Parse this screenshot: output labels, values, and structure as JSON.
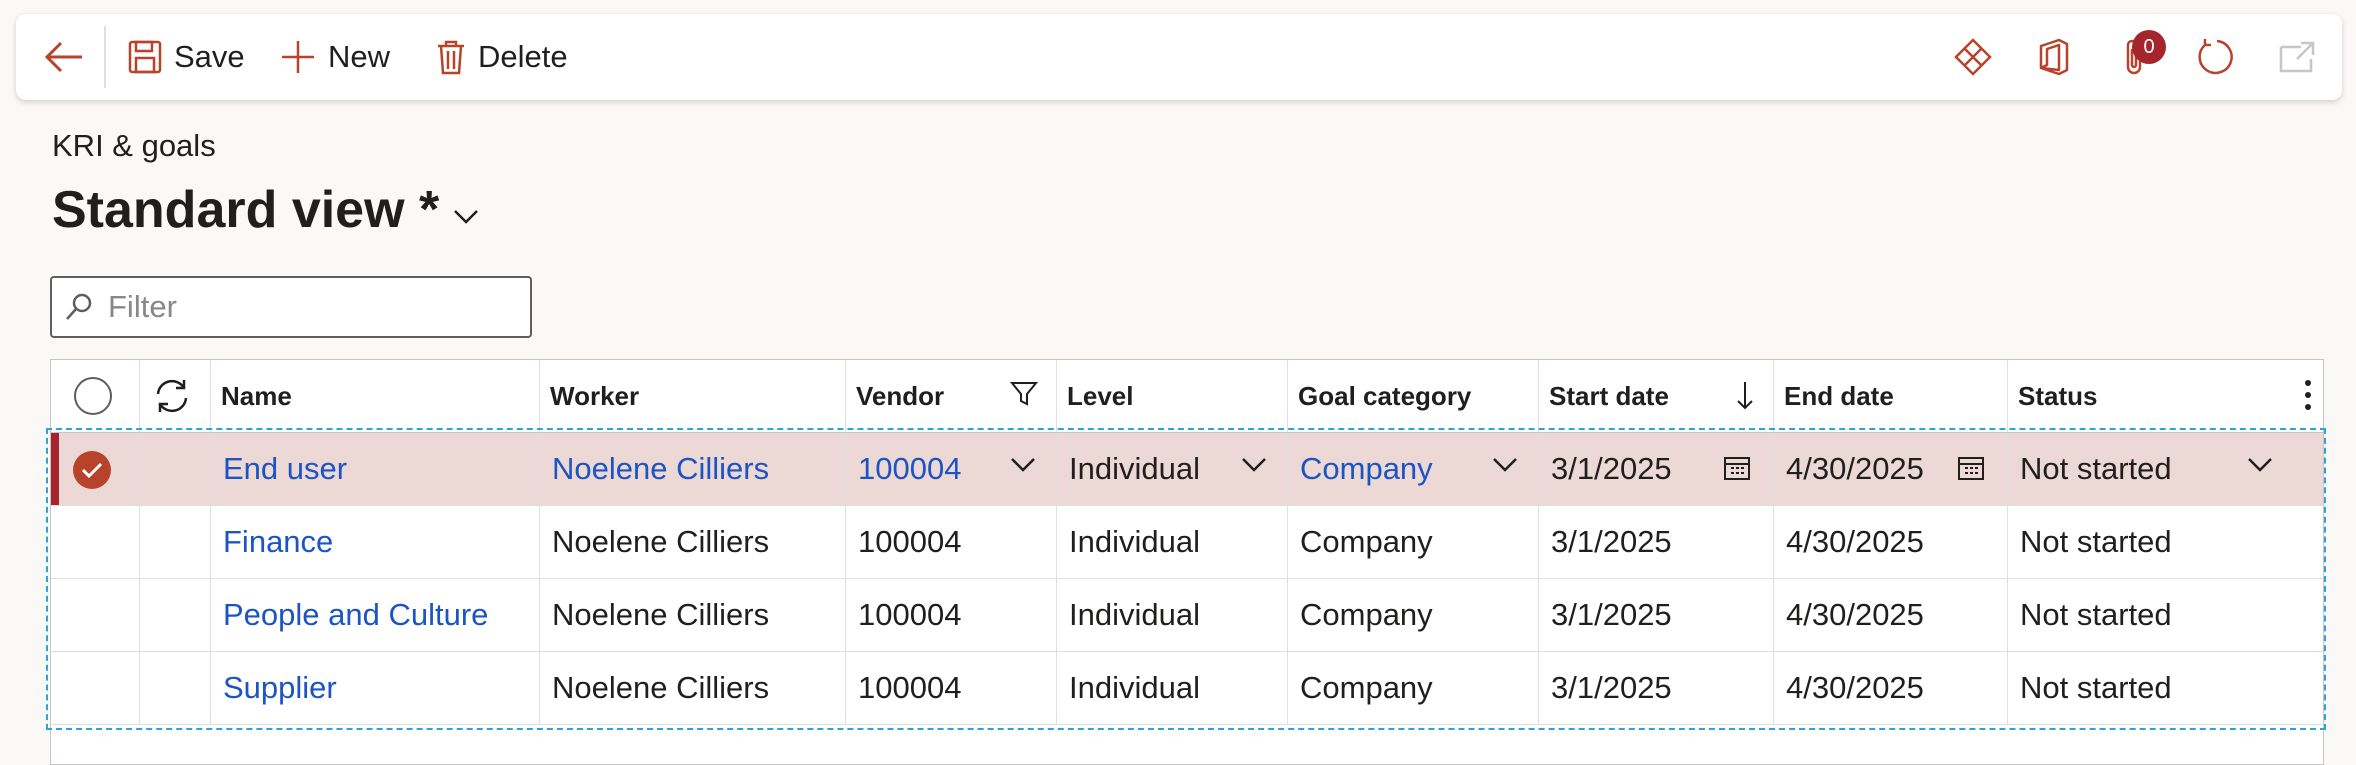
{
  "toolbar": {
    "save_label": "Save",
    "new_label": "New",
    "delete_label": "Delete",
    "attachments_count": "0"
  },
  "page": {
    "breadcrumb": "KRI & goals",
    "view_title": "Standard view *"
  },
  "filter": {
    "placeholder": "Filter"
  },
  "grid": {
    "columns": {
      "name": "Name",
      "worker": "Worker",
      "vendor": "Vendor",
      "level": "Level",
      "goal_category": "Goal category",
      "start_date": "Start date",
      "end_date": "End date",
      "status": "Status"
    },
    "rows": [
      {
        "name": "End user",
        "worker": "Noelene Cilliers",
        "vendor": "100004",
        "level": "Individual",
        "goal_category": "Company",
        "start_date": "3/1/2025",
        "end_date": "4/30/2025",
        "status": "Not started",
        "selected": true
      },
      {
        "name": "Finance",
        "worker": "Noelene Cilliers",
        "vendor": "100004",
        "level": "Individual",
        "goal_category": "Company",
        "start_date": "3/1/2025",
        "end_date": "4/30/2025",
        "status": "Not started"
      },
      {
        "name": "People and Culture",
        "worker": "Noelene Cilliers",
        "vendor": "100004",
        "level": "Individual",
        "goal_category": "Company",
        "start_date": "3/1/2025",
        "end_date": "4/30/2025",
        "status": "Not started"
      },
      {
        "name": "Supplier",
        "worker": "Noelene Cilliers",
        "vendor": "100004",
        "level": "Individual",
        "goal_category": "Company",
        "start_date": "3/1/2025",
        "end_date": "4/30/2025",
        "status": "Not started"
      }
    ]
  },
  "colors": {
    "accent": "#b8432b",
    "selected_row": "#ecd8d4",
    "link": "#1c54c4",
    "badge": "#a4262c"
  }
}
